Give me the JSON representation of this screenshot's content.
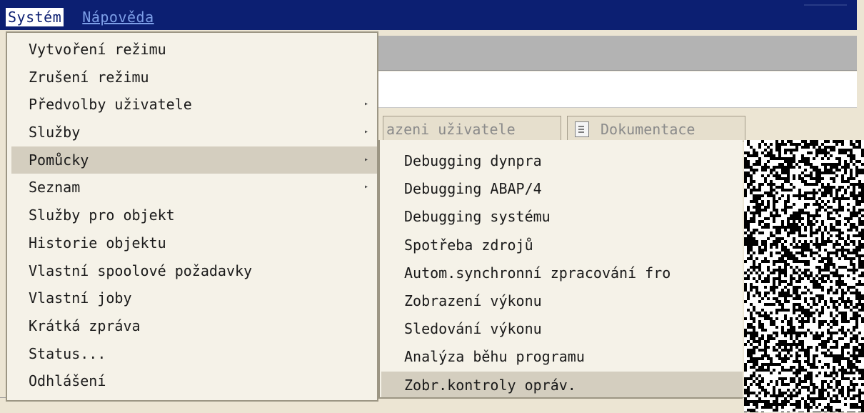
{
  "menubar": {
    "items": [
      {
        "label": "Systém",
        "active": true
      },
      {
        "label": "Nápověda",
        "active": false
      }
    ]
  },
  "background": {
    "button1_label": "azeni uživatele",
    "button2_label": "Dokumentace",
    "button2_icon": "document-icon"
  },
  "system_menu": {
    "items": [
      {
        "label": "Vytvoření režimu",
        "has_submenu": false
      },
      {
        "label": "Zrušení režimu",
        "has_submenu": false
      },
      {
        "label": "Předvolby uživatele",
        "has_submenu": true
      },
      {
        "label": "Služby",
        "has_submenu": true
      },
      {
        "label": "Pomůcky",
        "has_submenu": true,
        "selected": true
      },
      {
        "label": "Seznam",
        "has_submenu": true
      },
      {
        "label": "Služby pro objekt",
        "has_submenu": false
      },
      {
        "label": "Historie objektu",
        "has_submenu": false
      },
      {
        "label": "Vlastní spoolové požadavky",
        "has_submenu": false
      },
      {
        "label": "Vlastní joby",
        "has_submenu": false
      },
      {
        "label": "Krátká zpráva",
        "has_submenu": false
      },
      {
        "label": "Status...",
        "has_submenu": false
      },
      {
        "label": "Odhlášení",
        "has_submenu": false
      }
    ]
  },
  "tools_submenu": {
    "items": [
      {
        "label": "Debugging dynpra"
      },
      {
        "label": "Debugging ABAP/4"
      },
      {
        "label": "Debugging systému"
      },
      {
        "label": "Spotřeba zdrojů"
      },
      {
        "label": "Autom.synchronní zpracování fro"
      },
      {
        "label": "Zobrazení výkonu"
      },
      {
        "label": "Sledování výkonu"
      },
      {
        "label": "Analýza běhu programu"
      },
      {
        "label": "Zobr.kontroly opráv.",
        "selected": true
      }
    ]
  },
  "colors": {
    "menubar_bg": "#0c1f72",
    "menu_bg": "#f5f2e8",
    "selection_bg": "#d4cebf",
    "toolbar_bg": "#b3b3b3"
  }
}
